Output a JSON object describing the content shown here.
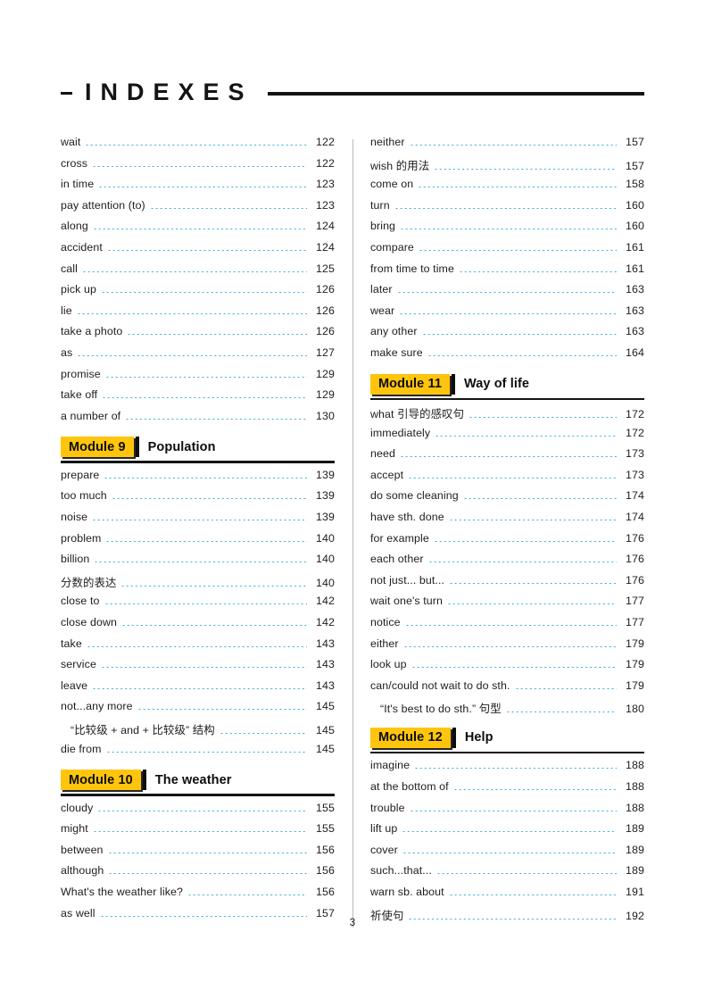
{
  "header": {
    "dash": "-",
    "title": "INDEXES"
  },
  "footer": {
    "page_number": "3"
  },
  "colors": {
    "module_badge_bg": "#FFC50D",
    "leader_dots": "#2BA9E0",
    "rule": "#141414",
    "text": "#1d1d1d"
  },
  "columns": [
    {
      "name": "left-column",
      "blocks": [
        {
          "type": "entries",
          "entries": [
            {
              "term": "wait",
              "page": "122"
            },
            {
              "term": "cross",
              "page": "122"
            },
            {
              "term": "in time",
              "page": "123"
            },
            {
              "term": "pay attention (to)",
              "page": "123"
            },
            {
              "term": "along",
              "page": "124"
            },
            {
              "term": "accident",
              "page": "124"
            },
            {
              "term": "call",
              "page": "125"
            },
            {
              "term": "pick up",
              "page": "126"
            },
            {
              "term": "lie",
              "page": "126"
            },
            {
              "term": "take a photo",
              "page": "126"
            },
            {
              "term": "as",
              "page": "127"
            },
            {
              "term": "promise",
              "page": "129"
            },
            {
              "term": "take off",
              "page": "129"
            },
            {
              "term": "a number of",
              "page": "130"
            }
          ]
        },
        {
          "type": "module",
          "badge": "Module 9",
          "title": "Population"
        },
        {
          "type": "entries",
          "entries": [
            {
              "term": "prepare",
              "page": "139"
            },
            {
              "term": "too much",
              "page": "139"
            },
            {
              "term": "noise",
              "page": "139"
            },
            {
              "term": "problem",
              "page": "140"
            },
            {
              "term": "billion",
              "page": "140"
            },
            {
              "term": "分数的表达",
              "page": "140"
            },
            {
              "term": "close to",
              "page": "142"
            },
            {
              "term": "close down",
              "page": "142"
            },
            {
              "term": "take",
              "page": "143"
            },
            {
              "term": "service",
              "page": "143"
            },
            {
              "term": "leave",
              "page": "143"
            },
            {
              "term": "not...any more",
              "page": "145"
            },
            {
              "term": "“比较级 + and + 比较级” 结构",
              "page": "145",
              "indented": true
            },
            {
              "term": "die from",
              "page": "145"
            }
          ]
        },
        {
          "type": "module",
          "badge": "Module 10",
          "title": "The weather"
        },
        {
          "type": "entries",
          "entries": [
            {
              "term": "cloudy",
              "page": "155"
            },
            {
              "term": "might",
              "page": "155"
            },
            {
              "term": "between",
              "page": "156"
            },
            {
              "term": "although",
              "page": "156"
            },
            {
              "term": "What's the weather like?",
              "page": "156"
            },
            {
              "term": "as well",
              "page": "157"
            }
          ]
        }
      ]
    },
    {
      "name": "right-column",
      "blocks": [
        {
          "type": "entries",
          "entries": [
            {
              "term": "neither",
              "page": "157"
            },
            {
              "term": "wish 的用法",
              "page": "157"
            },
            {
              "term": "come on",
              "page": "158"
            },
            {
              "term": "turn",
              "page": "160"
            },
            {
              "term": "bring",
              "page": "160"
            },
            {
              "term": "compare",
              "page": "161"
            },
            {
              "term": "from time to time",
              "page": "161"
            },
            {
              "term": "later",
              "page": "163"
            },
            {
              "term": "wear",
              "page": "163"
            },
            {
              "term": "any other",
              "page": "163"
            },
            {
              "term": "make sure",
              "page": "164"
            }
          ]
        },
        {
          "type": "module",
          "badge": "Module 11",
          "title": "Way of life"
        },
        {
          "type": "entries",
          "entries": [
            {
              "term": "what 引导的感叹句",
              "page": "172"
            },
            {
              "term": "immediately",
              "page": "172"
            },
            {
              "term": "need",
              "page": "173"
            },
            {
              "term": "accept",
              "page": "173"
            },
            {
              "term": "do some cleaning",
              "page": "174"
            },
            {
              "term": "have sth. done",
              "page": "174"
            },
            {
              "term": "for example",
              "page": "176"
            },
            {
              "term": "each other",
              "page": "176"
            },
            {
              "term": "not just... but...",
              "page": "176"
            },
            {
              "term": "wait one's turn",
              "page": "177"
            },
            {
              "term": "notice",
              "page": "177"
            },
            {
              "term": "either",
              "page": "179"
            },
            {
              "term": "look up",
              "page": "179"
            },
            {
              "term": "can/could not wait to do sth.",
              "page": "179"
            },
            {
              "term": "“It's best to do sth.” 句型",
              "page": "180",
              "indented": true
            }
          ]
        },
        {
          "type": "module",
          "badge": "Module 12",
          "title": "Help"
        },
        {
          "type": "entries",
          "entries": [
            {
              "term": "imagine",
              "page": "188"
            },
            {
              "term": "at the bottom of",
              "page": "188"
            },
            {
              "term": "trouble",
              "page": "188"
            },
            {
              "term": "lift up",
              "page": "189"
            },
            {
              "term": "cover",
              "page": "189"
            },
            {
              "term": "such...that...",
              "page": "189"
            },
            {
              "term": "warn sb. about",
              "page": "191"
            },
            {
              "term": "祈使句",
              "page": "192"
            }
          ]
        }
      ]
    }
  ]
}
